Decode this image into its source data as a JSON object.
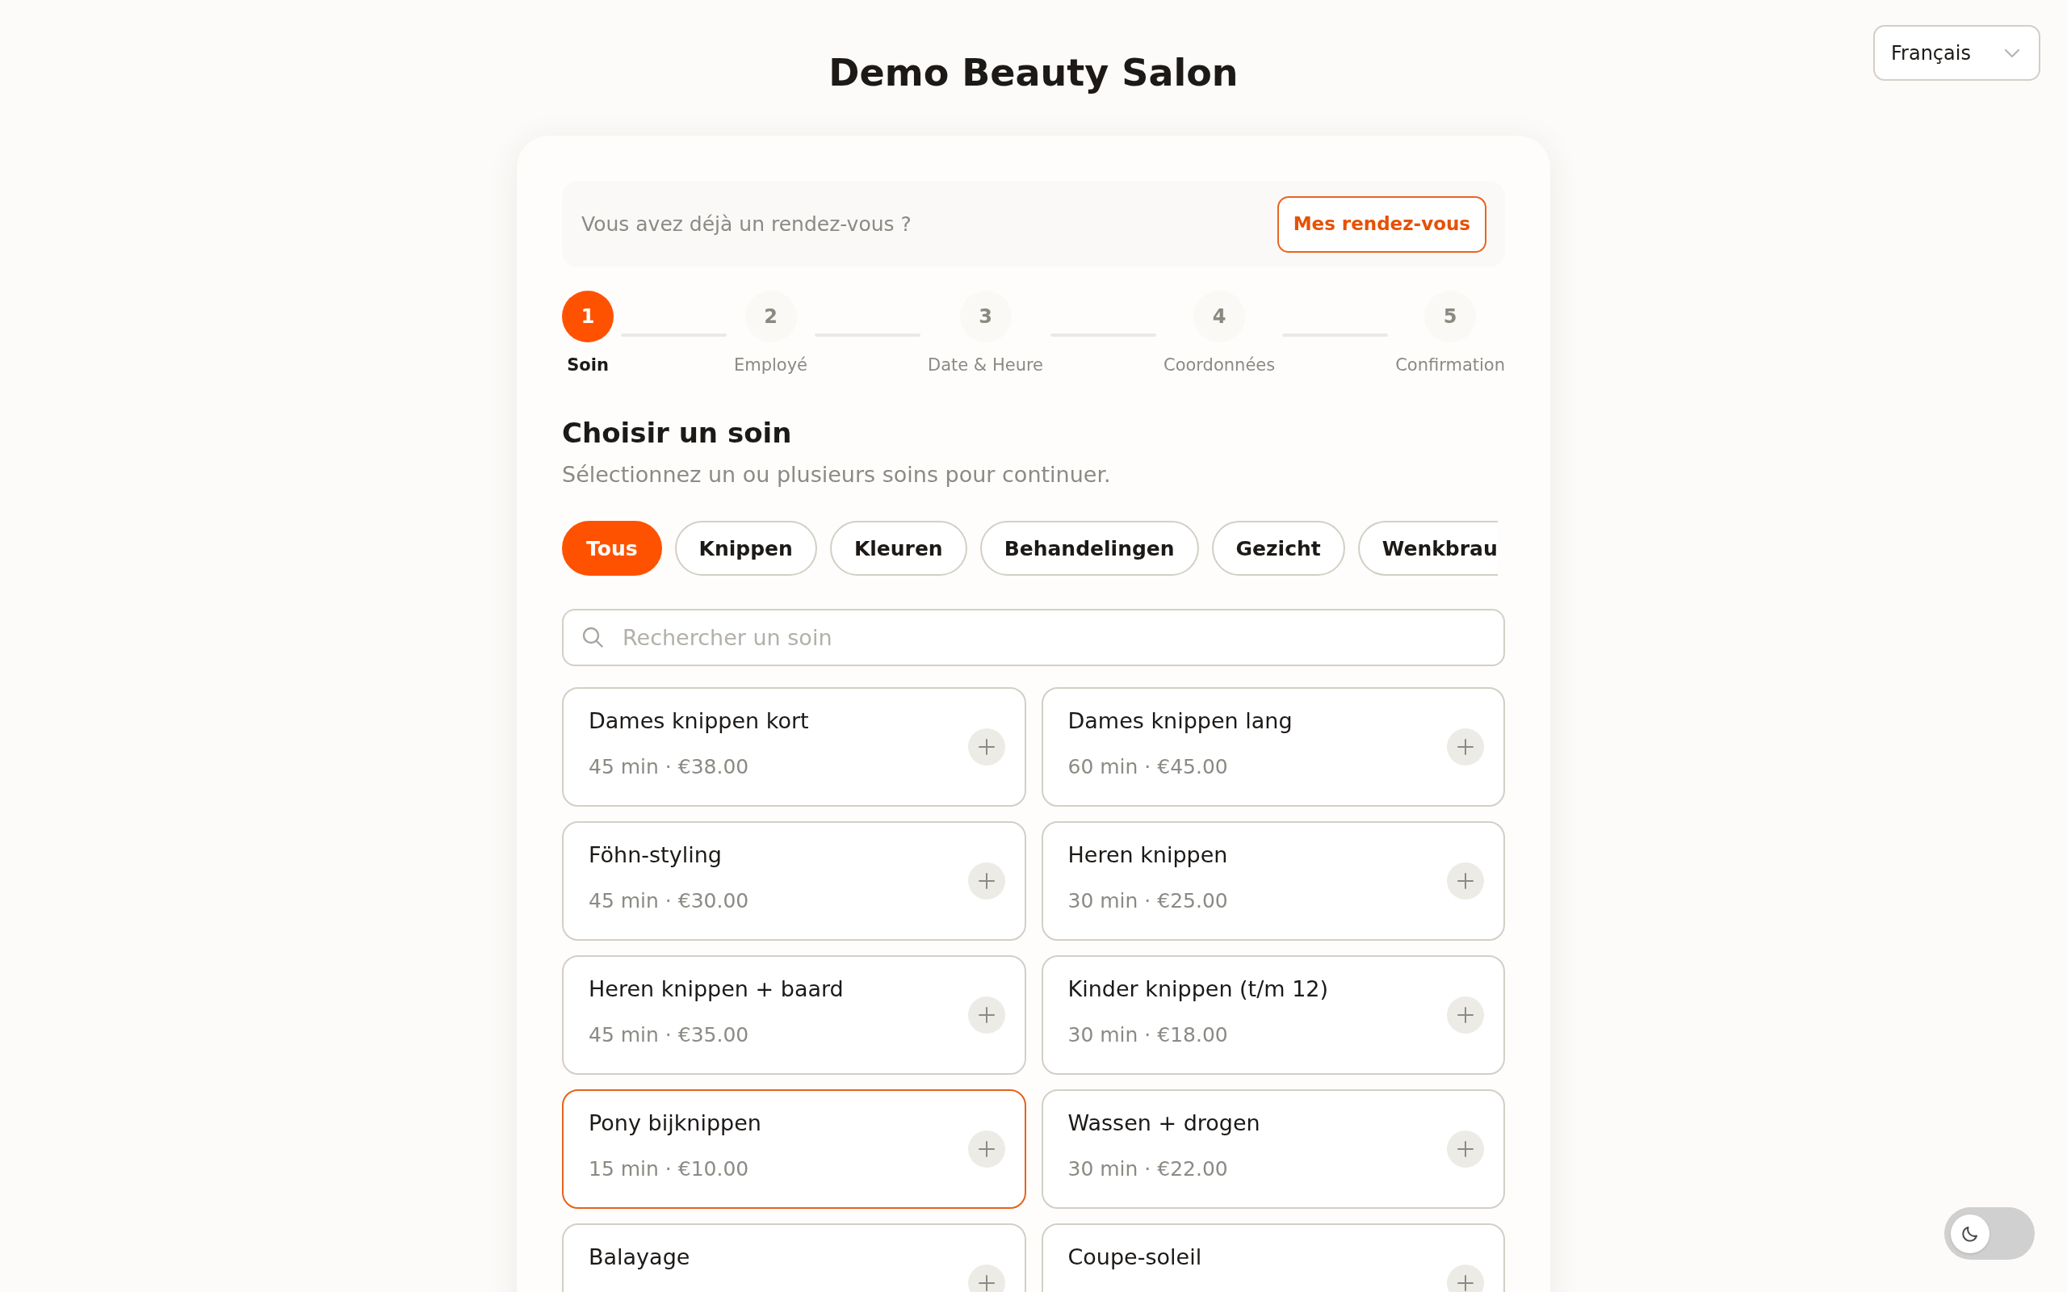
{
  "language_select": {
    "value": "Français"
  },
  "title": "Demo Beauty Salon",
  "existing_booking": {
    "prompt": "Vous avez déjà un rendez-vous ?",
    "button": "Mes rendez-vous"
  },
  "steps": [
    {
      "number": "1",
      "label": "Soin",
      "selected": true
    },
    {
      "number": "2",
      "label": "Employé",
      "selected": false
    },
    {
      "number": "3",
      "label": "Date & Heure",
      "selected": false
    },
    {
      "number": "4",
      "label": "Coordonnées",
      "selected": false
    },
    {
      "number": "5",
      "label": "Confirmation",
      "selected": false
    }
  ],
  "section": {
    "heading": "Choisir un soin",
    "subtitle": "Sélectionnez un ou plusieurs soins pour continuer."
  },
  "categories": [
    {
      "label": "Tous",
      "selected": true,
      "clipped": false
    },
    {
      "label": "Knippen",
      "selected": false,
      "clipped": false
    },
    {
      "label": "Kleuren",
      "selected": false,
      "clipped": false
    },
    {
      "label": "Behandelingen",
      "selected": false,
      "clipped": false
    },
    {
      "label": "Gezicht",
      "selected": false,
      "clipped": false
    },
    {
      "label": "Wenkbrau",
      "selected": false,
      "clipped": true
    }
  ],
  "search": {
    "placeholder": "Rechercher un soin"
  },
  "services": [
    {
      "name": "Dames knippen kort",
      "details": "45 min · €38.00",
      "selected": false
    },
    {
      "name": "Dames knippen lang",
      "details": "60 min · €45.00",
      "selected": false
    },
    {
      "name": "Föhn-styling",
      "details": "45 min · €30.00",
      "selected": false
    },
    {
      "name": "Heren knippen",
      "details": "30 min · €25.00",
      "selected": false
    },
    {
      "name": "Heren knippen + baard",
      "details": "45 min · €35.00",
      "selected": false
    },
    {
      "name": "Kinder knippen (t/m 12)",
      "details": "30 min · €18.00",
      "selected": false
    },
    {
      "name": "Pony bijknippen",
      "details": "15 min · €10.00",
      "selected": true
    },
    {
      "name": "Wassen + drogen",
      "details": "30 min · €22.00",
      "selected": false
    },
    {
      "name": "Balayage",
      "selected": false
    },
    {
      "name": "Coupe-soleil",
      "selected": false
    }
  ],
  "dark_mode_toggle": {
    "on": false
  }
}
